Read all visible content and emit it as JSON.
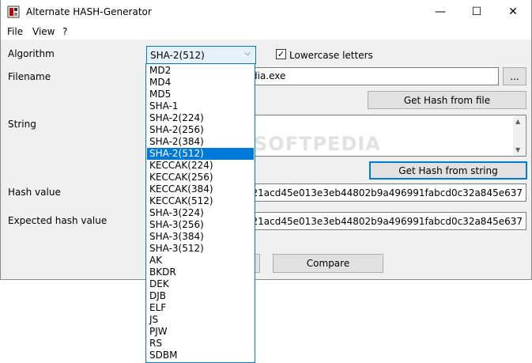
{
  "window": {
    "title": "Alternate HASH-Generator",
    "controls": {
      "minimize": "—",
      "maximize": "☐",
      "close": "✕"
    }
  },
  "menu": [
    "File",
    "View",
    "?"
  ],
  "labels": {
    "algorithm": "Algorithm",
    "filename": "Filename",
    "string": "String",
    "hash_value": "Hash value",
    "expected_hash_value": "Expected hash value"
  },
  "algorithm": {
    "selected": "SHA-2(512)",
    "options": [
      "MD2",
      "MD4",
      "MD5",
      "SHA-1",
      "SHA-2(224)",
      "SHA-2(256)",
      "SHA-2(384)",
      "SHA-2(512)",
      "KECCAK(224)",
      "KECCAK(256)",
      "KECCAK(384)",
      "KECCAK(512)",
      "SHA-3(224)",
      "SHA-3(256)",
      "SHA-3(384)",
      "SHA-3(512)",
      "AK",
      "BKDR",
      "DEK",
      "DJB",
      "ELF",
      "JS",
      "PJW",
      "RS",
      "SDBM"
    ]
  },
  "lowercase": {
    "label": "Lowercase letters",
    "checked": true,
    "mark": "✓"
  },
  "filename": {
    "value": "dia.exe",
    "browse_label": "..."
  },
  "buttons": {
    "hash_file": "Get Hash from file",
    "hash_string": "Get Hash from string",
    "compare": "Compare"
  },
  "hash_value": "46d30e97c721acd45e013e3eb44802b9a496991fabcd0c32a845e637",
  "expected_hash_value": "46d30e97c721acd45e013e3eb44802b9a496991fabcd0c32a845e637",
  "watermark": "SOFTPEDIA",
  "icons": {
    "dropdown": "chevron-down-icon",
    "scroll_up": "triangle-up-icon",
    "scroll_down": "triangle-down-icon"
  }
}
